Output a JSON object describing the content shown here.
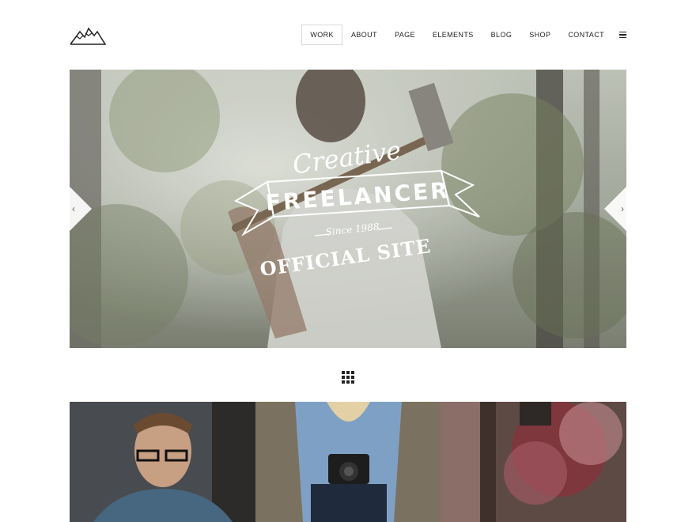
{
  "logo": {
    "icon": "mountain-logo-icon"
  },
  "nav": {
    "items": [
      {
        "label": "WORK",
        "active": true
      },
      {
        "label": "ABOUT",
        "active": false
      },
      {
        "label": "PAGE",
        "active": false
      },
      {
        "label": "ELEMENTS",
        "active": false
      },
      {
        "label": "BLOG",
        "active": false
      },
      {
        "label": "SHOP",
        "active": false
      },
      {
        "label": "CONTACT",
        "active": false
      }
    ],
    "menu_icon": "hamburger-icon"
  },
  "hero": {
    "badge": {
      "script": "Creative",
      "ribbon": "FREELANCER",
      "since": "Since 1988",
      "official": "OFFICIAL SITE"
    },
    "prev_icon": "chevron-left-icon",
    "next_icon": "chevron-right-icon"
  },
  "grid_toggle_icon": "grid-icon",
  "portfolio": {
    "tiles": [
      {
        "subject": "man-with-glasses"
      },
      {
        "subject": "woman-with-camera"
      },
      {
        "subject": "flowering-tree"
      }
    ]
  }
}
